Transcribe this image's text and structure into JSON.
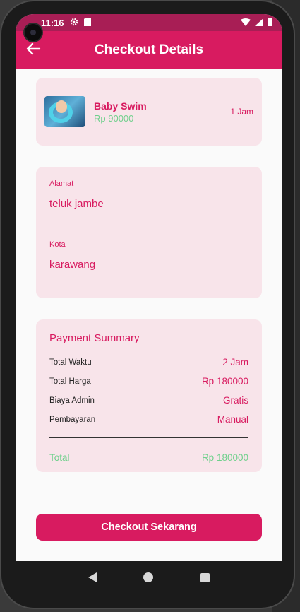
{
  "status": {
    "time": "11:16"
  },
  "appbar": {
    "title": "Checkout Details"
  },
  "product": {
    "name": "Baby Swim",
    "price": "Rp 90000",
    "duration": "1 Jam"
  },
  "address": {
    "alamat_label": "Alamat",
    "alamat_value": "teluk jambe",
    "kota_label": "Kota",
    "kota_value": "karawang"
  },
  "summary": {
    "title": "Payment Summary",
    "rows": [
      {
        "label": "Total Waktu",
        "value": "2 Jam"
      },
      {
        "label": "Total Harga",
        "value": "Rp 180000"
      },
      {
        "label": "Biaya Admin",
        "value": "Gratis"
      },
      {
        "label": "Pembayaran",
        "value": "Manual"
      }
    ],
    "total_label": "Total",
    "total_value": "Rp 180000"
  },
  "checkout": {
    "label": "Checkout Sekarang"
  },
  "colors": {
    "primary": "#d81b60",
    "status": "#a81e55",
    "card": "#f8e4ea",
    "accent_green": "#6fd08c"
  }
}
